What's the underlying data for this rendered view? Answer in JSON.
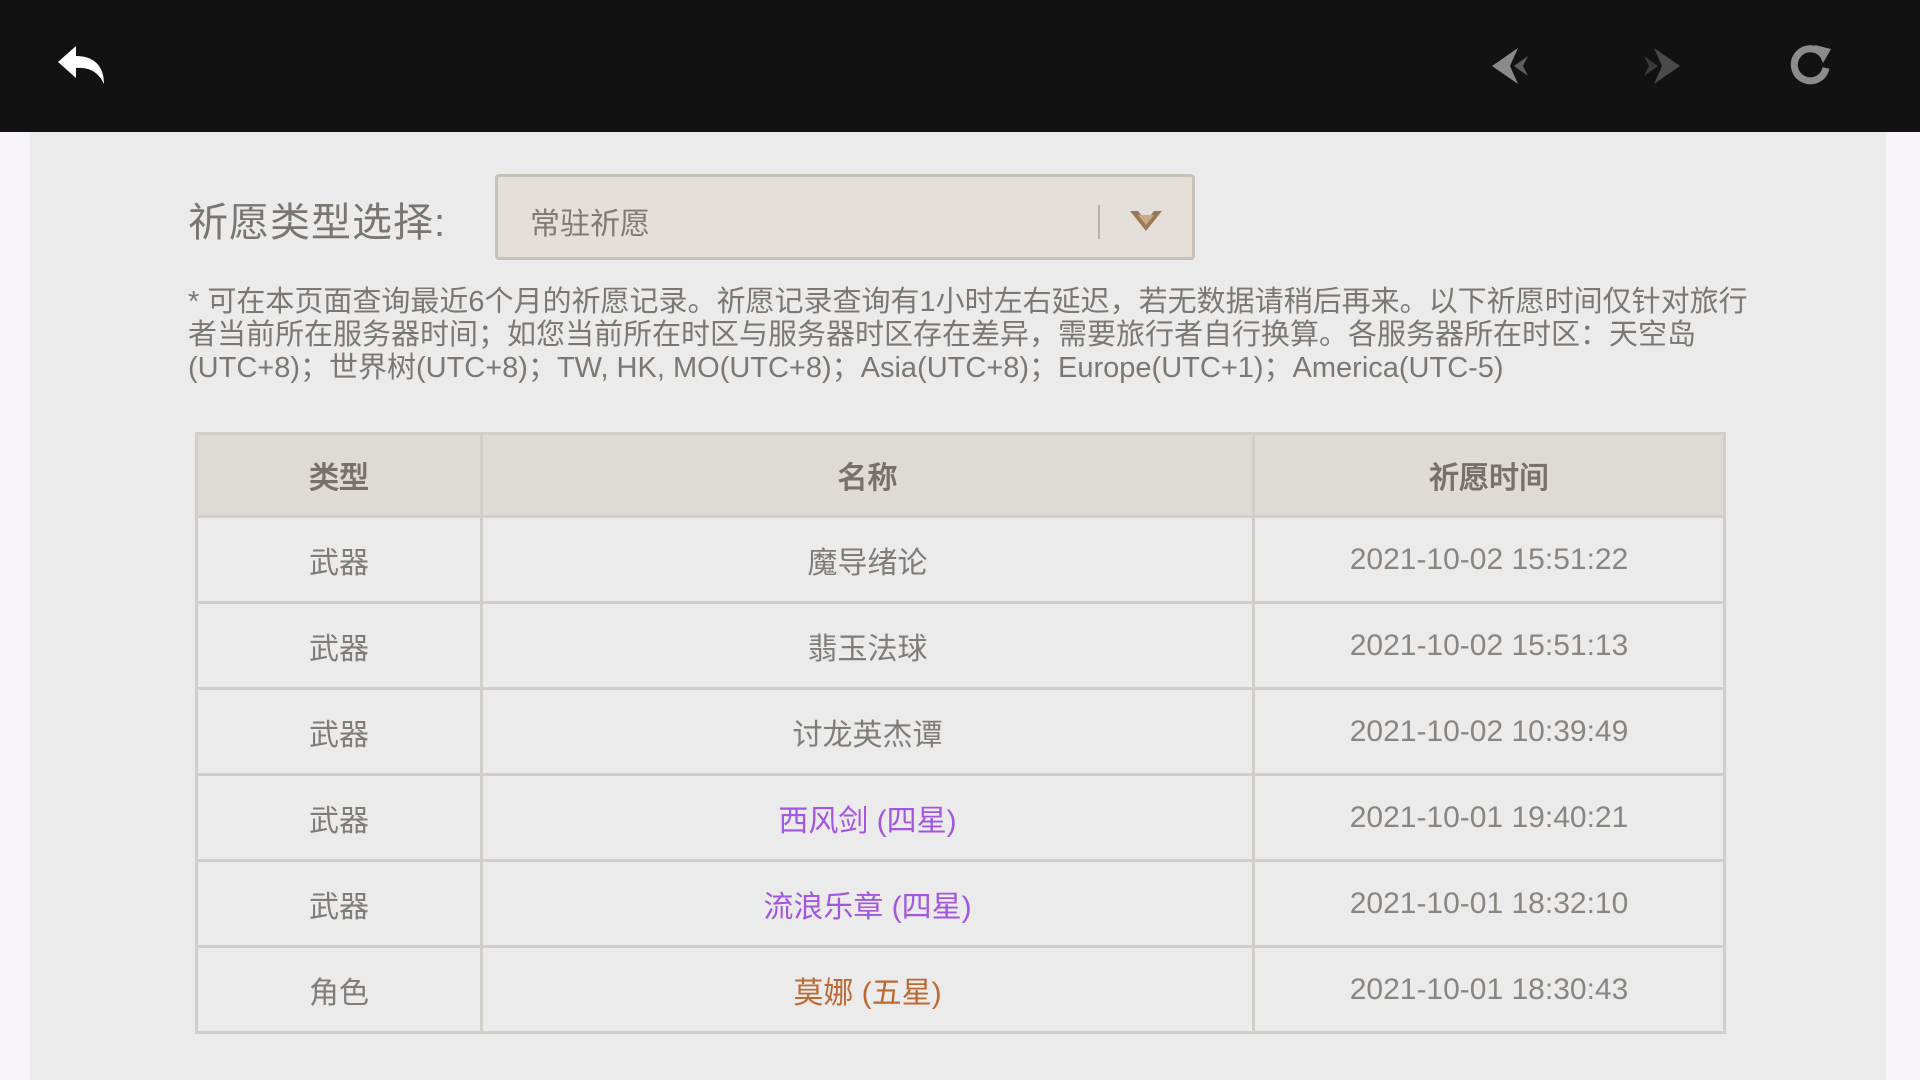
{
  "topbar": {
    "back_icon": "back-arrow-icon",
    "prev_icon": "nav-previous-icon",
    "next_icon": "nav-next-icon",
    "refresh_icon": "refresh-icon"
  },
  "selector": {
    "label": "祈愿类型选择:",
    "value": "常驻祈愿",
    "arrow_icon": "chevron-down-icon"
  },
  "notice": "* 可在本页面查询最近6个月的祈愿记录。祈愿记录查询有1小时左右延迟，若无数据请稍后再来。以下祈愿时间仅针对旅行者当前所在服务器时间；如您当前所在时区与服务器时区存在差异，需要旅行者自行换算。各服务器所在时区：天空岛(UTC+8)；世界树(UTC+8)；TW, HK, MO(UTC+8)；Asia(UTC+8)；Europe(UTC+1)；America(UTC-5)",
  "table": {
    "headers": [
      "类型",
      "名称",
      "祈愿时间"
    ],
    "rows": [
      {
        "type": "武器",
        "name": "魔导绪论",
        "time": "2021-10-02 15:51:22",
        "rarity": "3"
      },
      {
        "type": "武器",
        "name": "翡玉法球",
        "time": "2021-10-02 15:51:13",
        "rarity": "3"
      },
      {
        "type": "武器",
        "name": "讨龙英杰谭",
        "time": "2021-10-02 10:39:49",
        "rarity": "3"
      },
      {
        "type": "武器",
        "name": "西风剑 (四星)",
        "time": "2021-10-01 19:40:21",
        "rarity": "4"
      },
      {
        "type": "武器",
        "name": "流浪乐章 (四星)",
        "time": "2021-10-01 18:32:10",
        "rarity": "4"
      },
      {
        "type": "角色",
        "name": "莫娜 (五星)",
        "time": "2021-10-01 18:30:43",
        "rarity": "5"
      }
    ]
  },
  "colors": {
    "topbar": "#121213",
    "four_star": "#a256e1",
    "five_star": "#bd6932"
  }
}
